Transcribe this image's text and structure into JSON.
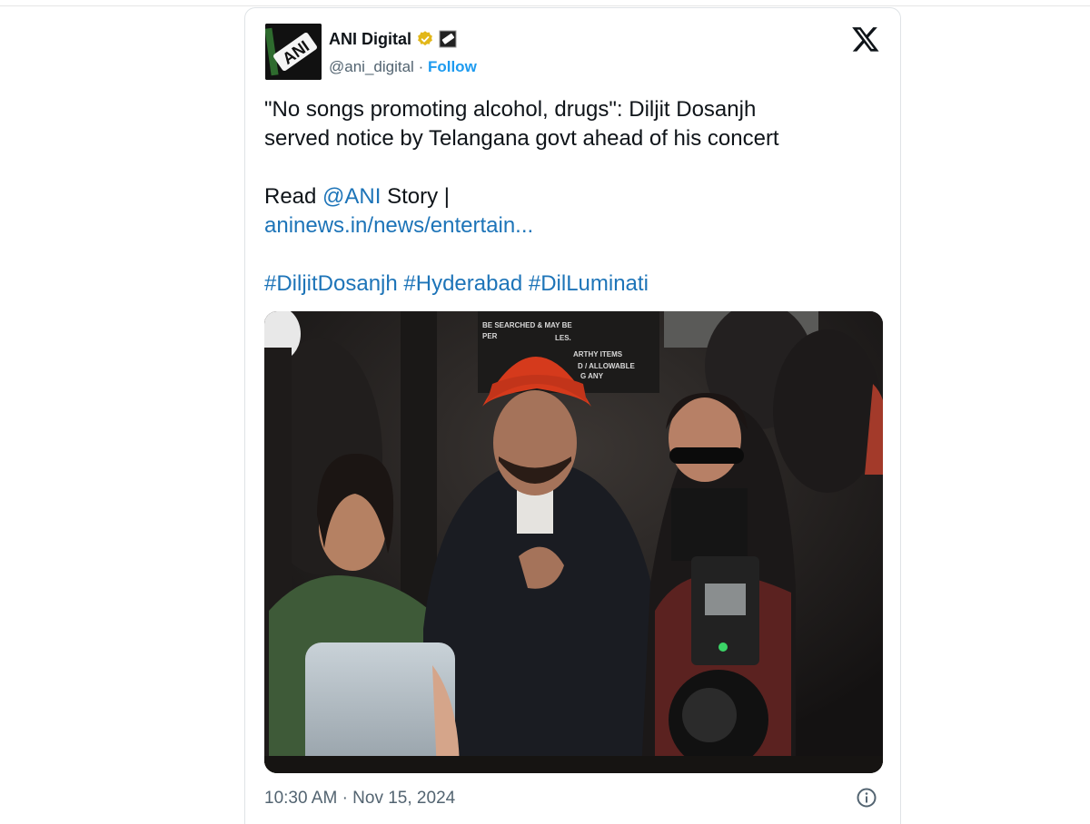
{
  "tweet": {
    "author_name": "ANI Digital",
    "author_handle": "@ani_digital",
    "separator": "·",
    "follow_label": "Follow",
    "avatar_text": "ANI",
    "verified_icon": "verified-badge-icon",
    "affiliate_icon": "ani-affiliate-icon",
    "platform_icon": "x-logo-icon",
    "text_line1": "\"No songs promoting alcohol, drugs\": Diljit Dosanjh",
    "text_line2": "served notice by Telangana govt ahead of his concert",
    "read_prefix": "Read ",
    "mention": "@ANI",
    "read_suffix": " Story |",
    "link_text": "aninews.in/news/entertain...",
    "hashtags": [
      "#DiljitDosanjh",
      "#Hyderabad",
      "#DilLuminati"
    ],
    "sign_lines": [
      "BE SEARCHED & MAY BE",
      "PER",
      "LES.",
      "ARTHY ITEMS",
      "D / ALLOWABLE",
      "G ANY"
    ],
    "time": "10:30 AM",
    "date": "Nov 15, 2024",
    "info_icon": "info-icon"
  },
  "colors": {
    "link": "#1d74b8",
    "follow": "#1d9bf0",
    "verified_gold": "#e2b719",
    "muted": "#536471",
    "turban": "#d9401f"
  }
}
